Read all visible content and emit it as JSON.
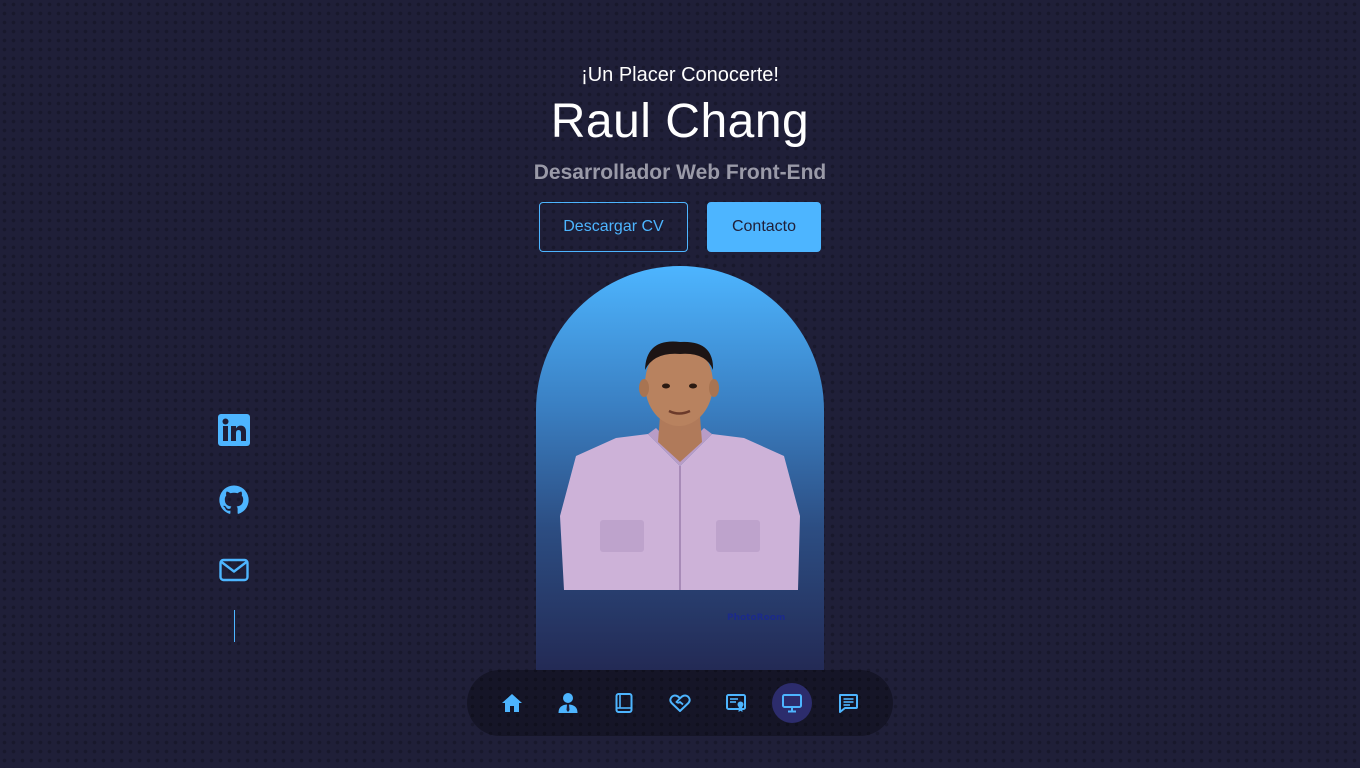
{
  "hero": {
    "greeting": "¡Un Placer Conocerte!",
    "name": "Raul Chang",
    "role": "Desarrollador Web Front-End"
  },
  "actions": {
    "download_cv": "Descargar CV",
    "contact": "Contacto"
  },
  "photo": {
    "watermark": "PhotoRoom"
  },
  "socials": [
    {
      "icon": "linkedin-icon"
    },
    {
      "icon": "github-icon"
    },
    {
      "icon": "mail-icon"
    }
  ],
  "nav": {
    "items": [
      {
        "icon": "home-icon"
      },
      {
        "icon": "user-icon"
      },
      {
        "icon": "book-icon"
      },
      {
        "icon": "handshake-icon"
      },
      {
        "icon": "certificate-icon"
      },
      {
        "icon": "monitor-icon",
        "active": true
      },
      {
        "icon": "message-icon"
      }
    ]
  },
  "colors": {
    "background": "#1f1f38",
    "accent": "#4db5ff",
    "muted_text": "#9a9aa8",
    "nav_active": "#2c2c6c"
  }
}
